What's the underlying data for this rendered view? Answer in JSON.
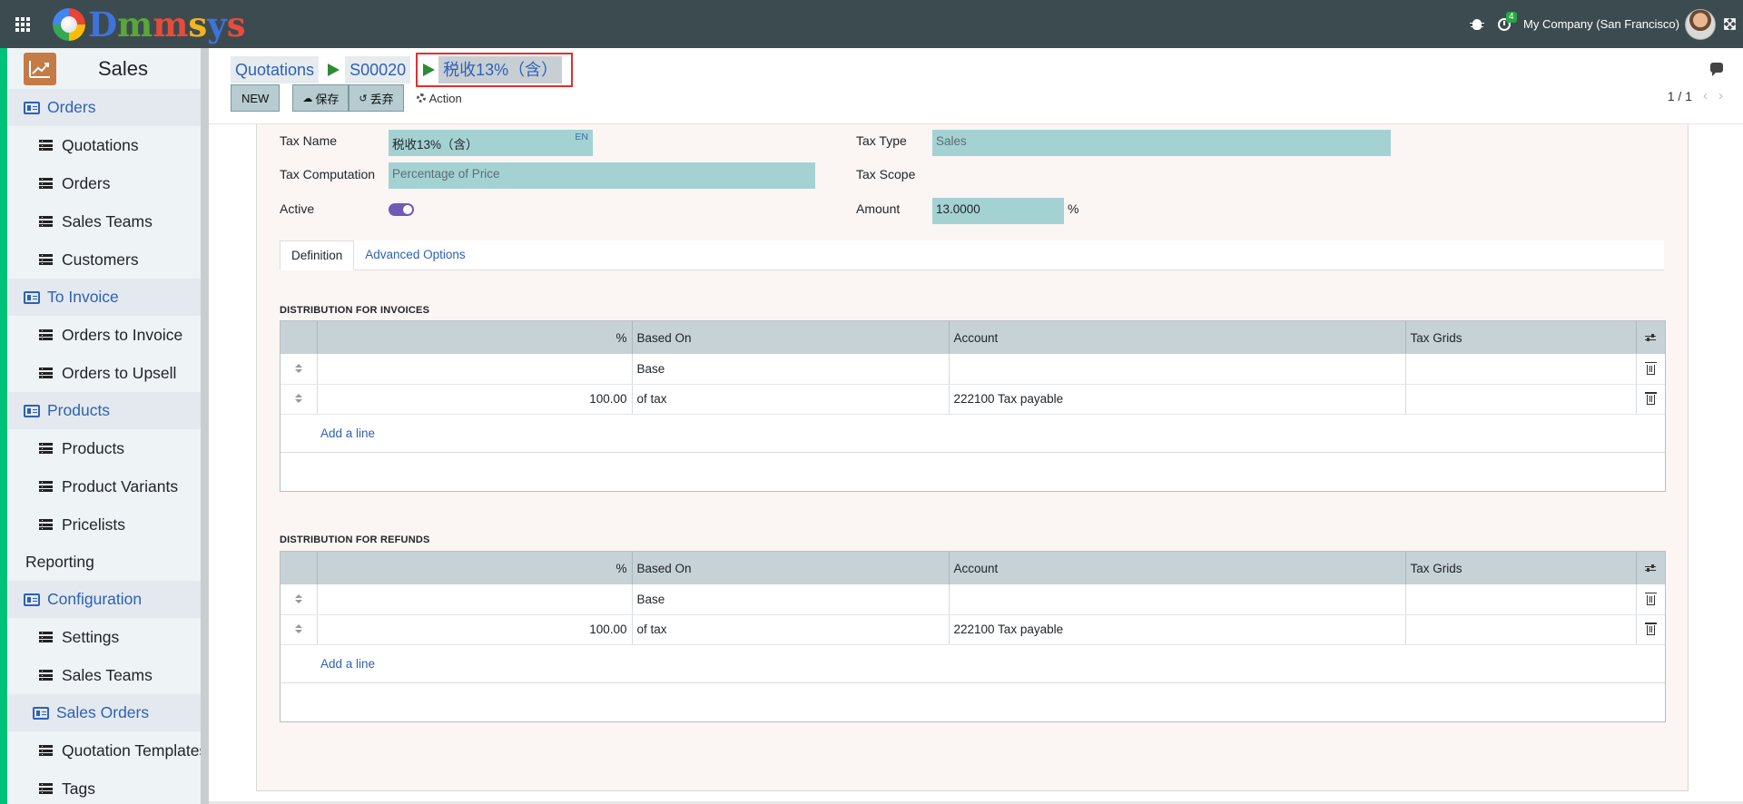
{
  "topbar": {
    "brand": "Dmmsys",
    "activity_count": "4",
    "company": "My Company (San Francisco)"
  },
  "sidebar": {
    "app_title": "Sales",
    "menu": [
      {
        "type": "section",
        "label": "Orders"
      },
      {
        "type": "item",
        "label": "Quotations"
      },
      {
        "type": "item",
        "label": "Orders"
      },
      {
        "type": "item",
        "label": "Sales Teams"
      },
      {
        "type": "item",
        "label": "Customers"
      },
      {
        "type": "section",
        "label": "To Invoice"
      },
      {
        "type": "item",
        "label": "Orders to Invoice"
      },
      {
        "type": "item",
        "label": "Orders to Upsell"
      },
      {
        "type": "section",
        "label": "Products"
      },
      {
        "type": "item",
        "label": "Products"
      },
      {
        "type": "item",
        "label": "Product Variants"
      },
      {
        "type": "item",
        "label": "Pricelists"
      },
      {
        "type": "plain",
        "label": "Reporting"
      },
      {
        "type": "section",
        "label": "Configuration"
      },
      {
        "type": "item",
        "label": "Settings"
      },
      {
        "type": "item",
        "label": "Sales Teams"
      },
      {
        "type": "subsection",
        "label": "Sales Orders"
      },
      {
        "type": "item",
        "label": "Quotation Templates"
      },
      {
        "type": "item",
        "label": "Tags"
      }
    ]
  },
  "breadcrumb": {
    "items": [
      "Quotations",
      "S00020"
    ],
    "current": "税收13%（含）"
  },
  "buttons": {
    "new": "NEW",
    "save": "保存",
    "discard": "丢弃",
    "action": "Action"
  },
  "pager": "1 / 1",
  "form": {
    "tax_name_label": "Tax Name",
    "tax_name_value": "税收13%（含）",
    "lang_badge": "EN",
    "tax_computation_label": "Tax Computation",
    "tax_computation_value": "Percentage of Price",
    "active_label": "Active",
    "tax_type_label": "Tax Type",
    "tax_type_value": "Sales",
    "tax_scope_label": "Tax Scope",
    "amount_label": "Amount",
    "amount_value": "13.0000",
    "amount_unit": "%"
  },
  "tabs": [
    "Definition",
    "Advanced Options"
  ],
  "columns": [
    "%",
    "Based On",
    "Account",
    "Tax Grids"
  ],
  "invoices": {
    "title": "DISTRIBUTION FOR INVOICES",
    "rows": [
      {
        "pct": "",
        "based_on": "Base",
        "account": "",
        "tax_grids": ""
      },
      {
        "pct": "100.00",
        "based_on": "of tax",
        "account": "222100 Tax payable",
        "tax_grids": ""
      }
    ],
    "add_line": "Add a line"
  },
  "refunds": {
    "title": "DISTRIBUTION FOR REFUNDS",
    "rows": [
      {
        "pct": "",
        "based_on": "Base",
        "account": "",
        "tax_grids": ""
      },
      {
        "pct": "100.00",
        "based_on": "of tax",
        "account": "222100 Tax payable",
        "tax_grids": ""
      }
    ],
    "add_line": "Add a line"
  }
}
